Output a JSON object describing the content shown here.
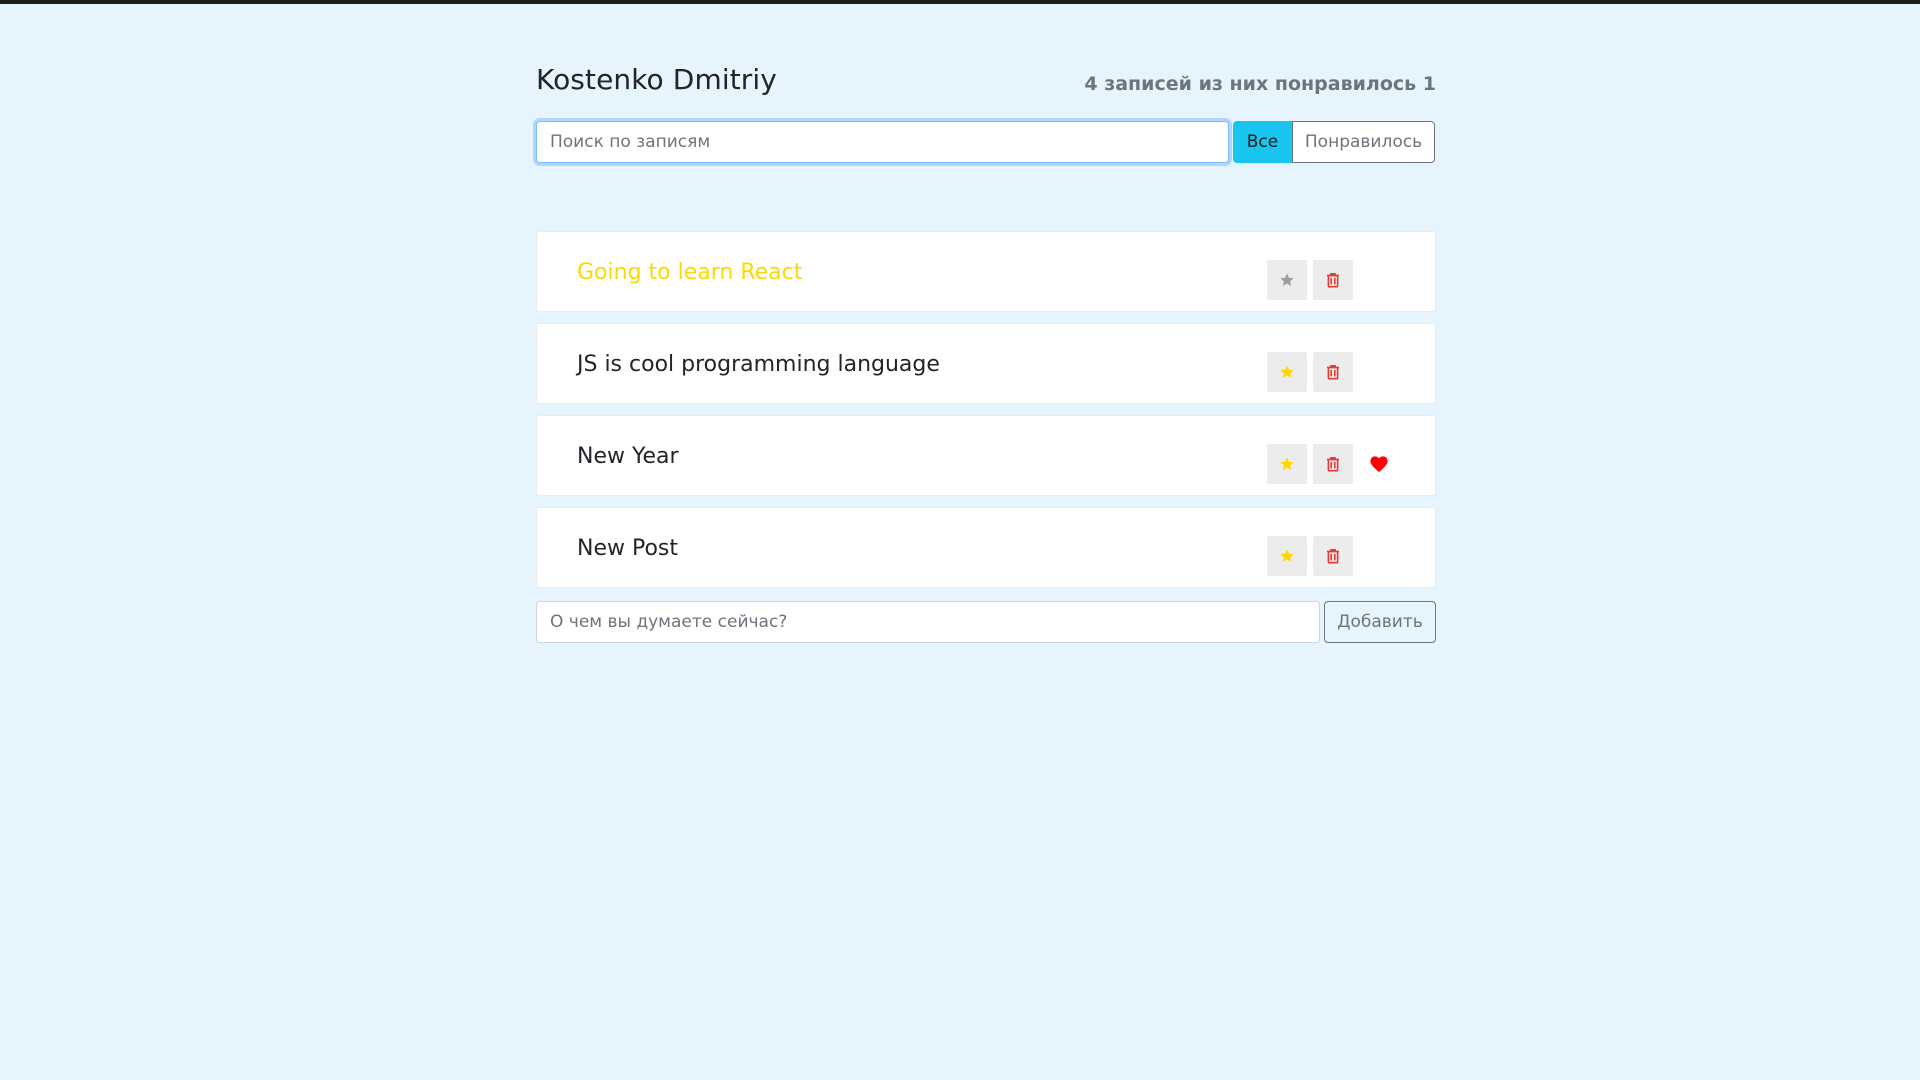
{
  "header": {
    "title": "Kostenko Dmitriy",
    "summary": "4 записей из них понравилось 1"
  },
  "search": {
    "placeholder": "Поиск по записям",
    "value": ""
  },
  "filters": {
    "all_label": "Все",
    "liked_label": "Понравилось",
    "active": "all"
  },
  "posts": [
    {
      "label": "Going to learn React",
      "important": true,
      "liked": false
    },
    {
      "label": "JS is cool programming language",
      "important": false,
      "liked": false
    },
    {
      "label": "New Year",
      "important": false,
      "liked": true
    },
    {
      "label": "New Post",
      "important": false,
      "liked": false
    }
  ],
  "add_form": {
    "placeholder": "О чем вы думаете сейчас?",
    "button_label": "Добавить"
  },
  "icons": {
    "star": "star-icon",
    "trash": "trash-icon",
    "heart": "heart-icon"
  },
  "colors": {
    "background": "#e6f4fd",
    "accent": "#17c5ee",
    "important_text": "#ffd700",
    "star": "#ffd700",
    "star_inactive": "#9e9e9e",
    "trash": "#e53935",
    "heart": "#ff0000"
  }
}
